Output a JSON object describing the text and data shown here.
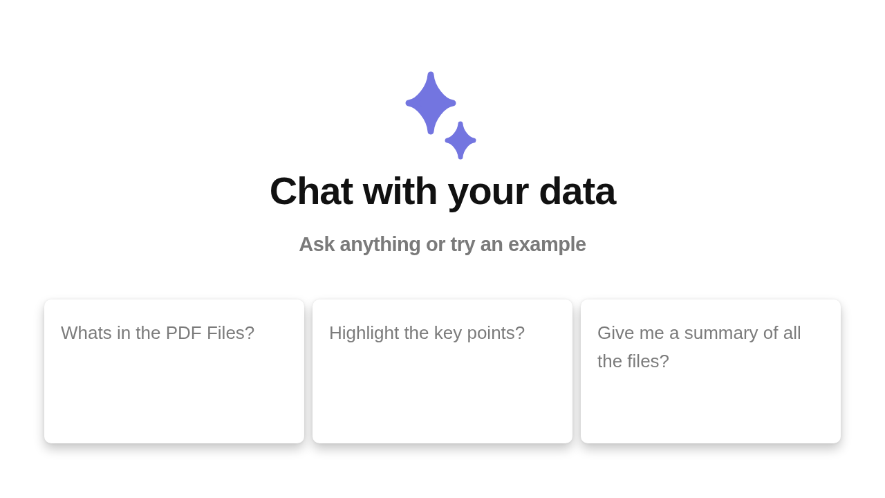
{
  "hero": {
    "title": "Chat with your data",
    "subtitle": "Ask anything or try an example"
  },
  "examples": [
    "Whats in the PDF Files?",
    "Highlight the key points?",
    "Give me a summary of all the files?"
  ]
}
